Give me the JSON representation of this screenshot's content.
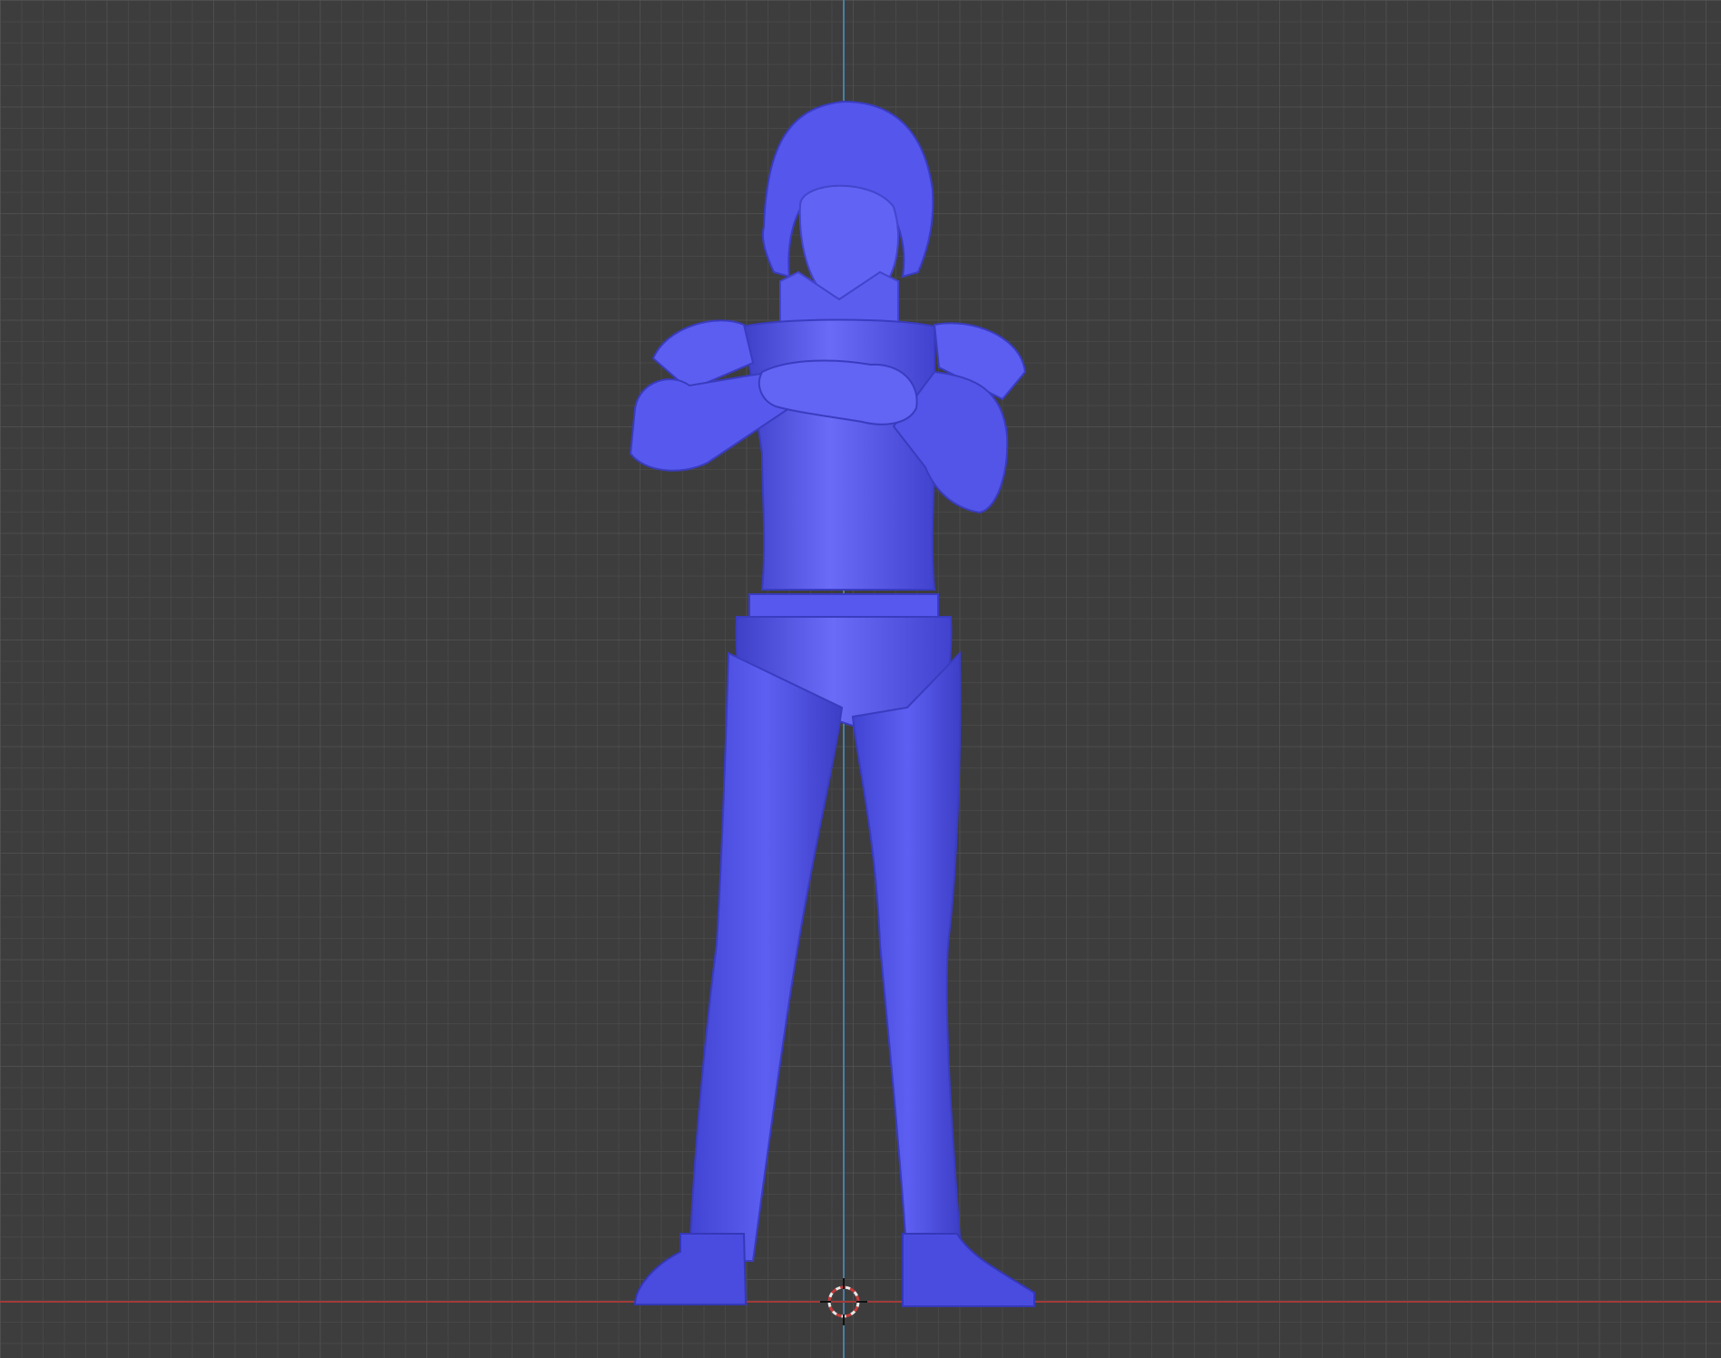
{
  "viewport": {
    "background_color": "#3d3d3d",
    "grid_color": "#474747",
    "axis_x_color": "#a03a3a",
    "axis_y_color": "#4a7fa6"
  },
  "model": {
    "color": "#5a5cf0",
    "shade_color": "#3f40c8",
    "highlight_color": "#7b7dff"
  },
  "cursor": {
    "icon": "3d-cursor-icon"
  }
}
